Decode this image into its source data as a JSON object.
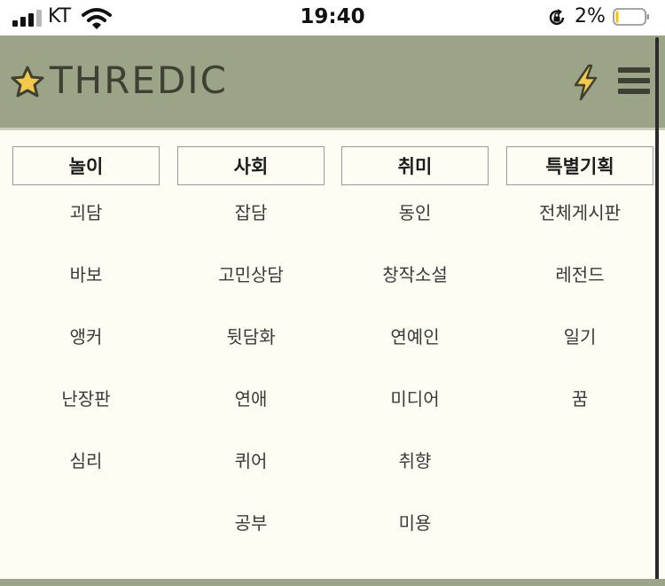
{
  "status_bar": {
    "carrier": "KT",
    "time": "19:40",
    "battery_percent": "2%",
    "battery_level": 0.02
  },
  "header": {
    "logo_text": "THREDIC",
    "bg_color": "#9ba486",
    "icons": [
      "star-icon",
      "lightning-bolt-icon",
      "hamburger-menu-icon"
    ]
  },
  "menu": {
    "columns": [
      {
        "title": "놀이",
        "items": [
          "괴담",
          "바보",
          "앵커",
          "난장판",
          "심리"
        ]
      },
      {
        "title": "사회",
        "items": [
          "잡담",
          "고민상담",
          "뒷담화",
          "연애",
          "퀴어",
          "공부"
        ]
      },
      {
        "title": "취미",
        "items": [
          "동인",
          "창작소설",
          "연예인",
          "미디어",
          "취향",
          "미용"
        ]
      },
      {
        "title": "특별기획",
        "items": [
          "전체게시판",
          "레전드",
          "일기",
          "꿈"
        ]
      }
    ]
  }
}
